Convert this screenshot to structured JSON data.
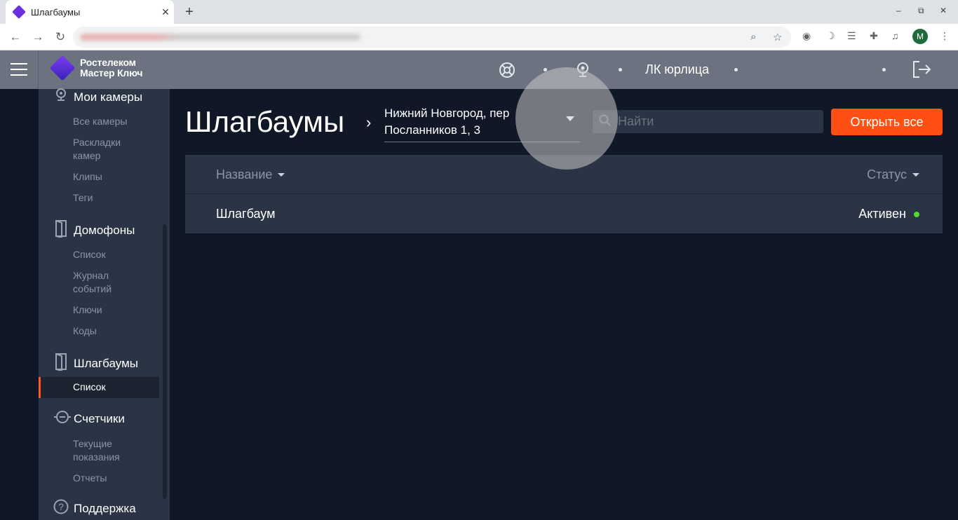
{
  "browser": {
    "tab_title": "Шлагбаумы",
    "tab_close": "✕",
    "new_tab": "+",
    "window_controls": [
      "‒",
      "⧉",
      "✕"
    ],
    "profile_initial": "M"
  },
  "header": {
    "logo_line1": "Ростелеком",
    "logo_line2": "Мастер Ключ",
    "account_label": "ЛК юрлица"
  },
  "sidebar": {
    "sections": [
      {
        "label": "Мои камеры",
        "icon": "camera-icon",
        "items": [
          "Все камеры",
          "Раскладки камер",
          "Клипы",
          "Теги"
        ]
      },
      {
        "label": "Домофоны",
        "icon": "door-icon",
        "items": [
          "Список",
          "Журнал событий",
          "Ключи",
          "Коды"
        ]
      },
      {
        "label": "Шлагбаумы",
        "icon": "barrier-icon",
        "items": [
          "Список"
        ]
      },
      {
        "label": "Счетчики",
        "icon": "meter-icon",
        "items": [
          "Текущие показания",
          "Отчеты"
        ]
      },
      {
        "label": "Поддержка",
        "icon": "help-icon",
        "items": []
      }
    ],
    "active_item": "Список"
  },
  "main": {
    "title": "Шлагбаумы",
    "address": "Нижний Новгород, пер Посланников 1, 3",
    "search_placeholder": "Найти",
    "open_all_label": "Открыть все",
    "table": {
      "columns": [
        "Название",
        "Статус"
      ],
      "rows": [
        {
          "name": "Шлагбаум",
          "status": "Активен",
          "status_color": "#4fdc2a"
        }
      ]
    }
  },
  "colors": {
    "accent": "#ff4f12",
    "active_status": "#4fdc2a"
  }
}
